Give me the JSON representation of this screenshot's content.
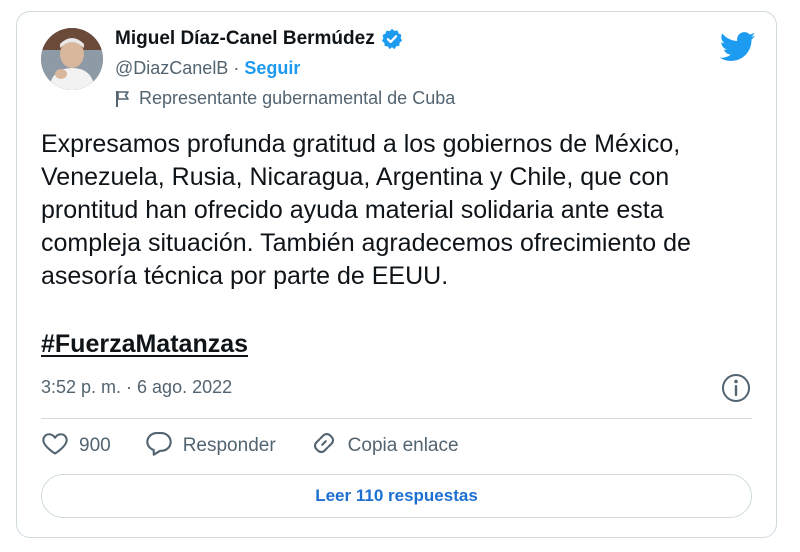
{
  "author": {
    "name": "Miguel Díaz-Canel Bermúdez",
    "handle": "@DiazCanelB",
    "separator": "·",
    "follow_label": "Seguir",
    "label": "Representante gubernamental de Cuba"
  },
  "tweet": {
    "text": "Expresamos profunda gratitud a los gobiernos de México, Venezuela, Rusia, Nicaragua, Argentina y Chile, que con prontitud han ofrecido ayuda material solidaria ante esta compleja situación. También agradecemos ofrecimiento de asesoría técnica por parte de EEUU.",
    "hashtag": "#FuerzaMatanzas",
    "timestamp": "3:52 p. m. · 6 ago. 2022"
  },
  "actions": {
    "likes_count": "900",
    "reply_label": "Responder",
    "copy_link_label": "Copia enlace"
  },
  "replies_button": "Leer 110 respuestas",
  "icons": {
    "avatar": "avatar",
    "verified": "verified-badge-icon",
    "logo": "twitter-bird-icon",
    "flag": "flag-icon",
    "info": "info-icon",
    "like": "heart-icon",
    "reply": "comment-icon",
    "link": "link-icon"
  },
  "colors": {
    "accent": "#1d9bf0",
    "text": "#0f1419",
    "muted": "#536471",
    "border": "#cfd9de"
  }
}
